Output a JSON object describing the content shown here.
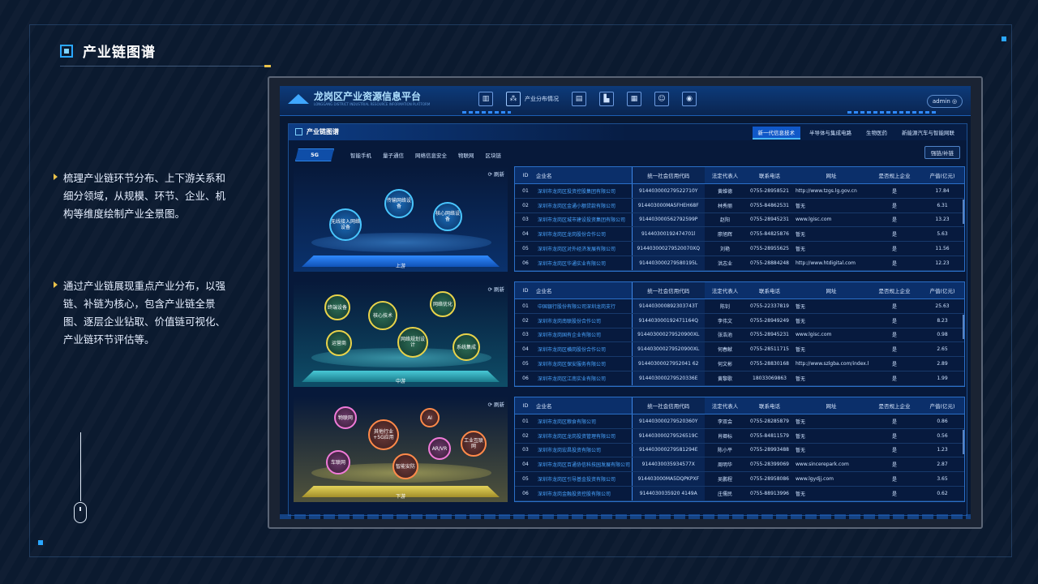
{
  "page": {
    "title": "产业链图谱",
    "descriptions": [
      "梳理产业链环节分布、上下游关系和细分领域，从规模、环节、企业、机构等维度绘制产业全景图。",
      "通过产业链展现重点产业分布，以强链、补链为核心，包含产业链全景图、逐层企业钻取、价值链可视化、产业链环节评估等。"
    ]
  },
  "app": {
    "title": "龙岗区产业资源信息平台",
    "subtitle": "LONGGANG DISTRICT INDUSTRIAL RESOURCE INFORMATION PLATFORM",
    "nav": [
      {
        "icon": "bar-chart-icon"
      },
      {
        "icon": "distribution-icon",
        "label": "产业分布情况"
      },
      {
        "icon": "document-icon"
      },
      {
        "icon": "factory-icon"
      },
      {
        "icon": "building-icon"
      },
      {
        "icon": "person-icon"
      },
      {
        "icon": "map-pin-icon"
      }
    ],
    "user": "admin"
  },
  "panel": {
    "title": "产业链图谱",
    "tabs": [
      "新一代信息技术",
      "半导体与集成电路",
      "生物医药",
      "新能源汽车与智能网联"
    ],
    "active_tab": 0,
    "sub_tabs": [
      "5G",
      "智能手机",
      "量子通信",
      "网络信息安全",
      "物联网",
      "区块链"
    ],
    "strong_button": "强链/补链",
    "refresh_label": "刷新"
  },
  "stages": [
    {
      "label": "上游",
      "bubbles": [
        "无线接入网络设备",
        "传输网络设备",
        "核心网络设备"
      ]
    },
    {
      "label": "中游",
      "bubbles": [
        "终端设备",
        "核心技术",
        "网络优化",
        "运营商",
        "网络规划设计",
        "系统集成"
      ]
    },
    {
      "label": "下游",
      "bubbles": [
        "物联网",
        "其他行业+5G应用",
        "AI",
        "AR/VR",
        "工业互联网",
        "车联网",
        "智能安防"
      ]
    }
  ],
  "table_headers": [
    "ID",
    "企业名",
    "统一社会信用代码",
    "法定代表人",
    "联系电话",
    "网址",
    "是否规上企业",
    "产值(亿元)"
  ],
  "tables": [
    [
      [
        "01",
        "深圳市龙岗区投资控股集团有限公司",
        "914403000279522710Y",
        "黄维德",
        "0755-28958521",
        "http://www.tzgs.lg.gov.cn",
        "是",
        "17.84"
      ],
      [
        "02",
        "深圳市龙岗区金通小额贷款有限公司",
        "914403000MA5FHEH68F",
        "林秀丽",
        "0755-84862531",
        "暂无",
        "是",
        "6.31"
      ],
      [
        "03",
        "深圳市龙岗区城市建设投资集团有限公司",
        "914403000562792599P",
        "赵阳",
        "0755-28945231",
        "www.lgisc.com",
        "是",
        "13.23"
      ],
      [
        "04",
        "深圳市龙岗区龙岗股份合作公司",
        "91440300192474701l",
        "廖旭辉",
        "0755-84825876",
        "暂无",
        "是",
        "5.63"
      ],
      [
        "05",
        "深圳市龙岗区对外经济发展有限公司",
        "914403000279520070XQ",
        "刘艳",
        "0755-28955625",
        "暂无",
        "是",
        "11.56"
      ],
      [
        "06",
        "深圳市龙岗区华通实业有限公司",
        "914403000279580195L",
        "洪志业",
        "0755-28884248",
        "http://www.htdigital.com",
        "是",
        "12.23"
      ]
    ],
    [
      [
        "01",
        "中国银行股份有限公司深圳龙岗支行",
        "914403000892303743T",
        "陈钊",
        "0755-22337819",
        "暂无",
        "是",
        "25.63"
      ],
      [
        "02",
        "深圳市龙岗南联股份合作公司",
        "914403000192471164Q",
        "李伟文",
        "0755-28949249",
        "暂无",
        "是",
        "8.23"
      ],
      [
        "03",
        "深圳市龙岗国有企业有限公司",
        "914403000279520900XL",
        "张浩池",
        "0755-28945231",
        "www.lgisc.com",
        "是",
        "0.98"
      ],
      [
        "04",
        "深圳市龙岗区横岗股份合作公司",
        "914403000279520900XL",
        "何春献",
        "0755-28511715",
        "暂无",
        "是",
        "2.65"
      ],
      [
        "05",
        "深圳市龙岗区保安服务有限公司",
        "91440300027952041 62",
        "何文彬",
        "0755-28830168",
        "http://www.szlgba.com/index.html",
        "是",
        "2.89"
      ],
      [
        "06",
        "深圳市龙岗区江南实业有限公司",
        "914403000279520336E",
        "黄黎歌",
        "18033069863",
        "暂无",
        "是",
        "1.99"
      ]
    ],
    [
      [
        "01",
        "深圳市龙岗区粮食有限公司",
        "914403000279520360Y",
        "李双会",
        "0755-28285879",
        "暂无",
        "是",
        "0.86"
      ],
      [
        "02",
        "深圳市龙岗区龙岗投资管理有限公司",
        "914403000279526519C",
        "肖卿标",
        "0755-84811579",
        "暂无",
        "是",
        "0.56"
      ],
      [
        "03",
        "深圳市龙岗宏昌投资有限公司",
        "914403000279581294E",
        "陈小平",
        "0755-28993488",
        "暂无",
        "是",
        "1.23"
      ],
      [
        "04",
        "深圳市龙岗区百通协信科技园发展有限公司",
        "9144030035934577X",
        "周明华",
        "0755-28399069",
        "www.sincerepark.com",
        "是",
        "2.87"
      ],
      [
        "05",
        "深圳市龙岗区引导基金投资有限公司",
        "914403000MA5DQPKPXF",
        "吴鹏程",
        "0755-28958086",
        "www.lgydjj.com",
        "是",
        "3.65"
      ],
      [
        "06",
        "深圳市龙岗金融投资控股有限公司",
        "9144030035920 4149A",
        "庄儒民",
        "0755-88913996",
        "暂无",
        "是",
        "0.62"
      ]
    ]
  ]
}
